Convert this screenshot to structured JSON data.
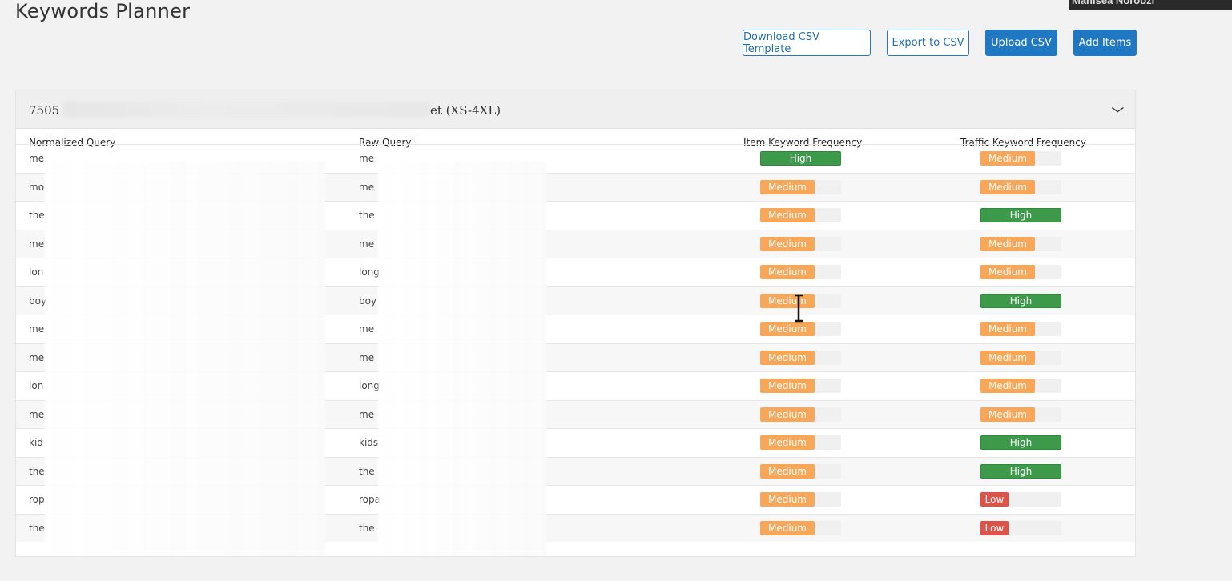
{
  "page": {
    "title": "Keywords Planner"
  },
  "user": {
    "name": "Manisea Noroozi"
  },
  "toolbar": {
    "download_template_label": "Download CSV Template",
    "export_label": "Export to CSV",
    "upload_label": "Upload CSV",
    "add_items_label": "Add Items"
  },
  "panel": {
    "title_prefix": "7505",
    "title_suffix": "et (XS-4XL)",
    "columns": {
      "normalized": "Normalized Query",
      "raw": "Raw Query",
      "item_freq": "Item Keyword Frequency",
      "traffic_freq": "Traffic Keyword Frequency"
    },
    "rows": [
      {
        "norm": "me",
        "raw": "me",
        "item": "High",
        "traffic": "Medium"
      },
      {
        "norm": "mo",
        "raw": "me",
        "item": "Medium",
        "traffic": "Medium"
      },
      {
        "norm": "the",
        "raw": "the",
        "item": "Medium",
        "traffic": "High"
      },
      {
        "norm": "me",
        "raw": "me",
        "item": "Medium",
        "traffic": "Medium"
      },
      {
        "norm": "lon",
        "raw": "long",
        "item": "Medium",
        "traffic": "Medium"
      },
      {
        "norm": "boy",
        "raw": "boy",
        "item": "Medium",
        "traffic": "High"
      },
      {
        "norm": "me",
        "raw": "me",
        "item": "Medium",
        "traffic": "Medium"
      },
      {
        "norm": "me",
        "raw": "me",
        "item": "Medium",
        "traffic": "Medium"
      },
      {
        "norm": "lon",
        "raw": "long",
        "item": "Medium",
        "traffic": "Medium"
      },
      {
        "norm": "me",
        "raw": "me",
        "item": "Medium",
        "traffic": "Medium"
      },
      {
        "norm": "kid",
        "raw": "kids",
        "item": "Medium",
        "traffic": "High"
      },
      {
        "norm": "the",
        "raw": "the",
        "item": "Medium",
        "traffic": "High"
      },
      {
        "norm": "rop",
        "raw": "ropa",
        "item": "Medium",
        "traffic": "Low"
      },
      {
        "norm": "the",
        "raw": "the",
        "item": "Medium",
        "traffic": "Low"
      }
    ]
  },
  "colors": {
    "high": "#3d9a4b",
    "medium": "#f7a757",
    "low": "#e05247",
    "primary": "#1f78c1"
  },
  "icons": {
    "collapse": "chevron-down-icon",
    "cursor": "text-cursor-icon"
  }
}
